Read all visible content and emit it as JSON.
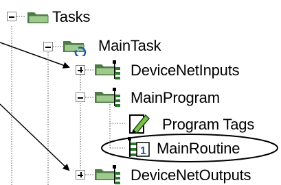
{
  "tree": {
    "items": [
      {
        "label": "Tasks",
        "expander": "minus",
        "icon": "tasks-folder-icon"
      },
      {
        "label": "MainTask",
        "expander": "minus",
        "icon": "main-task-icon"
      },
      {
        "label": "DeviceNetInputs",
        "expander": "plus",
        "icon": "program-folder-icon"
      },
      {
        "label": "MainProgram",
        "expander": "minus",
        "icon": "program-folder-icon"
      },
      {
        "label": "Program Tags",
        "expander": "none",
        "icon": "program-tags-icon"
      },
      {
        "label": "MainRoutine",
        "expander": "none",
        "icon": "main-routine-icon",
        "highlighted": true
      },
      {
        "label": "DeviceNetOutputs",
        "expander": "plus",
        "icon": "program-folder-icon"
      }
    ]
  },
  "colors": {
    "folder_green": "#9fca8d",
    "folder_dark": "#4e7a45",
    "line": "#8a8a8a"
  }
}
